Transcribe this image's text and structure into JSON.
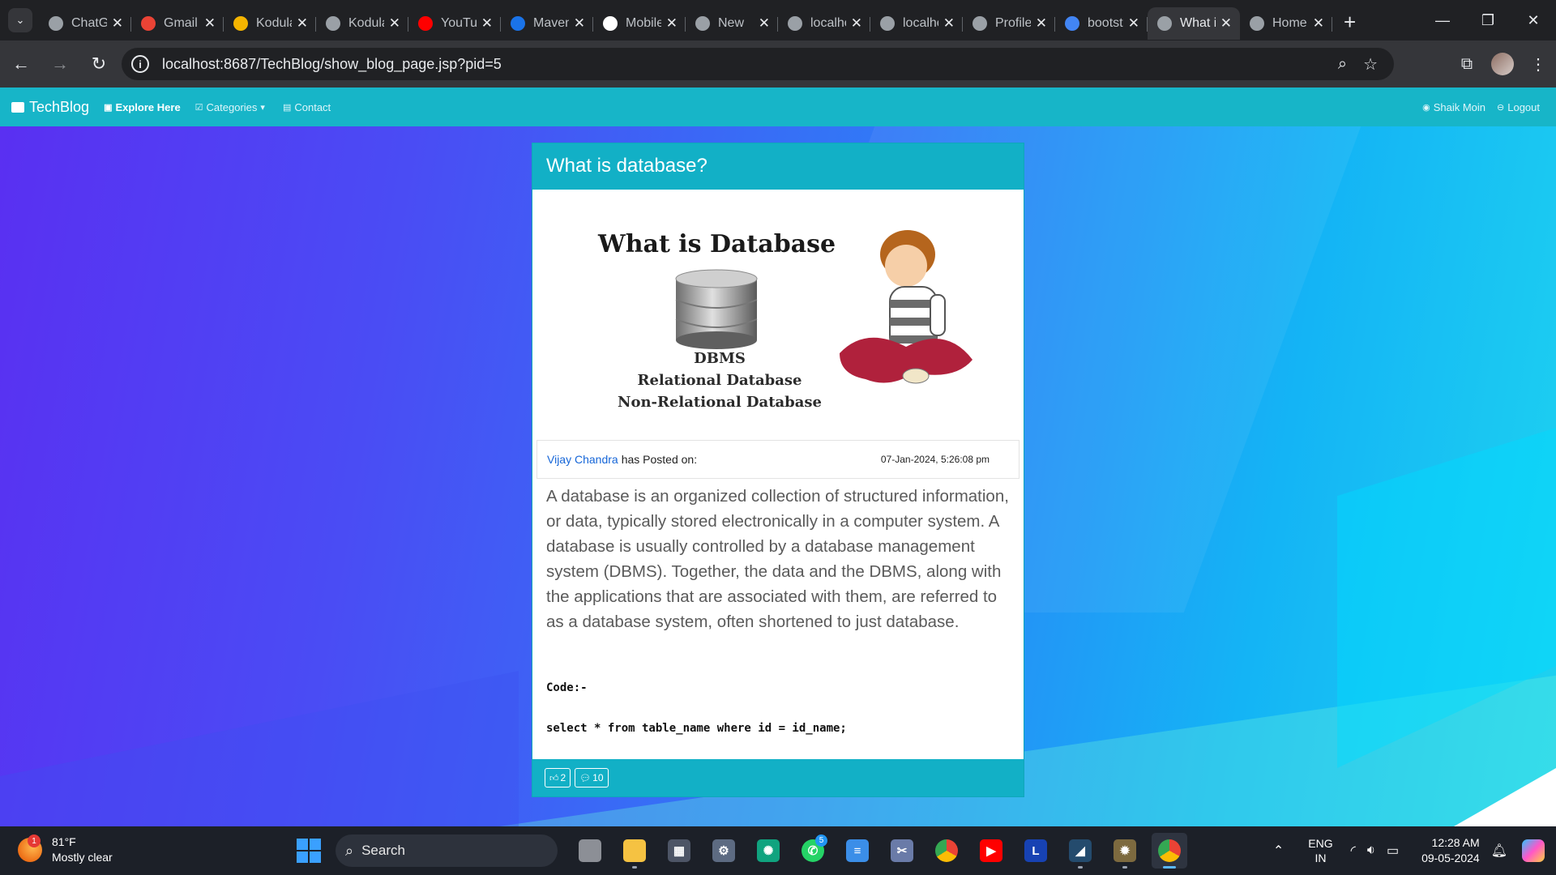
{
  "browser": {
    "tabs": [
      {
        "title": "ChatGPT",
        "icon": "chatgpt-icon",
        "color": "#9aa0a6"
      },
      {
        "title": "Gmail",
        "icon": "gmail-icon",
        "color": "#ea4335"
      },
      {
        "title": "Kodular",
        "icon": "kodular-icon",
        "color": "#f4b400"
      },
      {
        "title": "Kodular",
        "icon": "globe-icon",
        "color": "#9aa0a6"
      },
      {
        "title": "YouTube",
        "icon": "youtube-icon",
        "color": "#ff0000"
      },
      {
        "title": "Maven",
        "icon": "maven-icon",
        "color": "#1a73e8"
      },
      {
        "title": "Mobile",
        "icon": "github-icon",
        "color": "#ffffff"
      },
      {
        "title": "New",
        "icon": "globe-icon",
        "color": "#9aa0a6"
      },
      {
        "title": "localhost",
        "icon": "globe-icon",
        "color": "#9aa0a6"
      },
      {
        "title": "localhost",
        "icon": "globe-icon",
        "color": "#9aa0a6"
      },
      {
        "title": "Profile",
        "icon": "globe-icon",
        "color": "#9aa0a6"
      },
      {
        "title": "bootstrap",
        "icon": "google-icon",
        "color": "#4285f4"
      },
      {
        "title": "What is database?",
        "icon": "globe-icon",
        "color": "#9aa0a6",
        "active": true
      },
      {
        "title": "Home",
        "icon": "globe-icon",
        "color": "#9aa0a6"
      }
    ],
    "url": "localhost:8687/TechBlog/show_blog_page.jsp?pid=5"
  },
  "site": {
    "brand": "TechBlog",
    "nav": {
      "explore": "Explore Here",
      "categories": "Categories",
      "contact": "Contact",
      "user": "Shaik Moin",
      "logout": "Logout"
    }
  },
  "post": {
    "title": "What is database?",
    "image": {
      "heading": "What is Database",
      "line1": "DBMS",
      "line2": "Relational Database",
      "line3": "Non-Relational Database"
    },
    "author": "Vijay Chandra",
    "posted_label": "has Posted on:",
    "date": "07-Jan-2024, 5:26:08 pm",
    "content": "A database is an organized collection of structured information, or data, typically stored electronically in a computer system. A database is usually controlled by a database management system (DBMS). Together, the data and the DBMS, along with the applications that are associated with them, are referred to as a database system, often shortened to just database.",
    "code_label": "Code:-",
    "code": "select * from table_name where id = id_name;",
    "likes": "2",
    "comments": "10"
  },
  "taskbar": {
    "weather_temp": "81°F",
    "weather_desc": "Mostly clear",
    "weather_badge": "1",
    "search_label": "Search",
    "whatsapp_badge": "5",
    "lang1": "ENG",
    "lang2": "IN",
    "time": "12:28 AM",
    "date": "09-05-2024"
  }
}
